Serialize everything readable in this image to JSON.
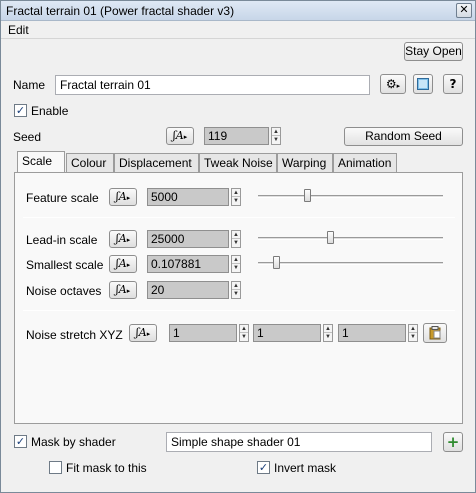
{
  "window": {
    "title": "Fractal terrain 01    (Power fractal shader v3)",
    "close_glyph": "✕"
  },
  "menu": {
    "items": [
      "Edit"
    ]
  },
  "header": {
    "stay_open_label": "Stay Open",
    "name_label": "Name",
    "name_value": "Fractal terrain 01",
    "enable_label": "Enable",
    "enable_checked": true,
    "seed_label": "Seed",
    "seed_value": "119",
    "random_seed_label": "Random Seed",
    "help_glyph": "?",
    "gear_glyph": "⚙"
  },
  "tabs": [
    "Scale",
    "Colour",
    "Displacement",
    "Tweak Noise",
    "Warping",
    "Animation"
  ],
  "active_tab": "Scale",
  "fx_glyph": "ʃA",
  "scale": {
    "feature_scale": {
      "label": "Feature scale",
      "value": "5000",
      "slider": 0.27
    },
    "lead_in_scale": {
      "label": "Lead-in scale",
      "value": "25000",
      "slider": 0.39
    },
    "smallest_scale": {
      "label": "Smallest scale",
      "value": "0.107881",
      "slider": 0.1
    },
    "noise_octaves": {
      "label": "Noise octaves",
      "value": "20"
    },
    "noise_stretch": {
      "label": "Noise stretch XYZ",
      "x": "1",
      "y": "1",
      "z": "1"
    }
  },
  "mask": {
    "mask_by_shader_label": "Mask by shader",
    "mask_by_shader_checked": true,
    "shader_value": "Simple shape shader 01",
    "add_glyph": "+",
    "fit_mask_label": "Fit mask to this",
    "fit_mask_checked": false,
    "invert_mask_label": "Invert mask",
    "invert_mask_checked": true
  },
  "colors": {
    "checkmark": "#1a3f7a",
    "add_icon": "#2e8b2e",
    "clipboard": "#c89a2a"
  }
}
